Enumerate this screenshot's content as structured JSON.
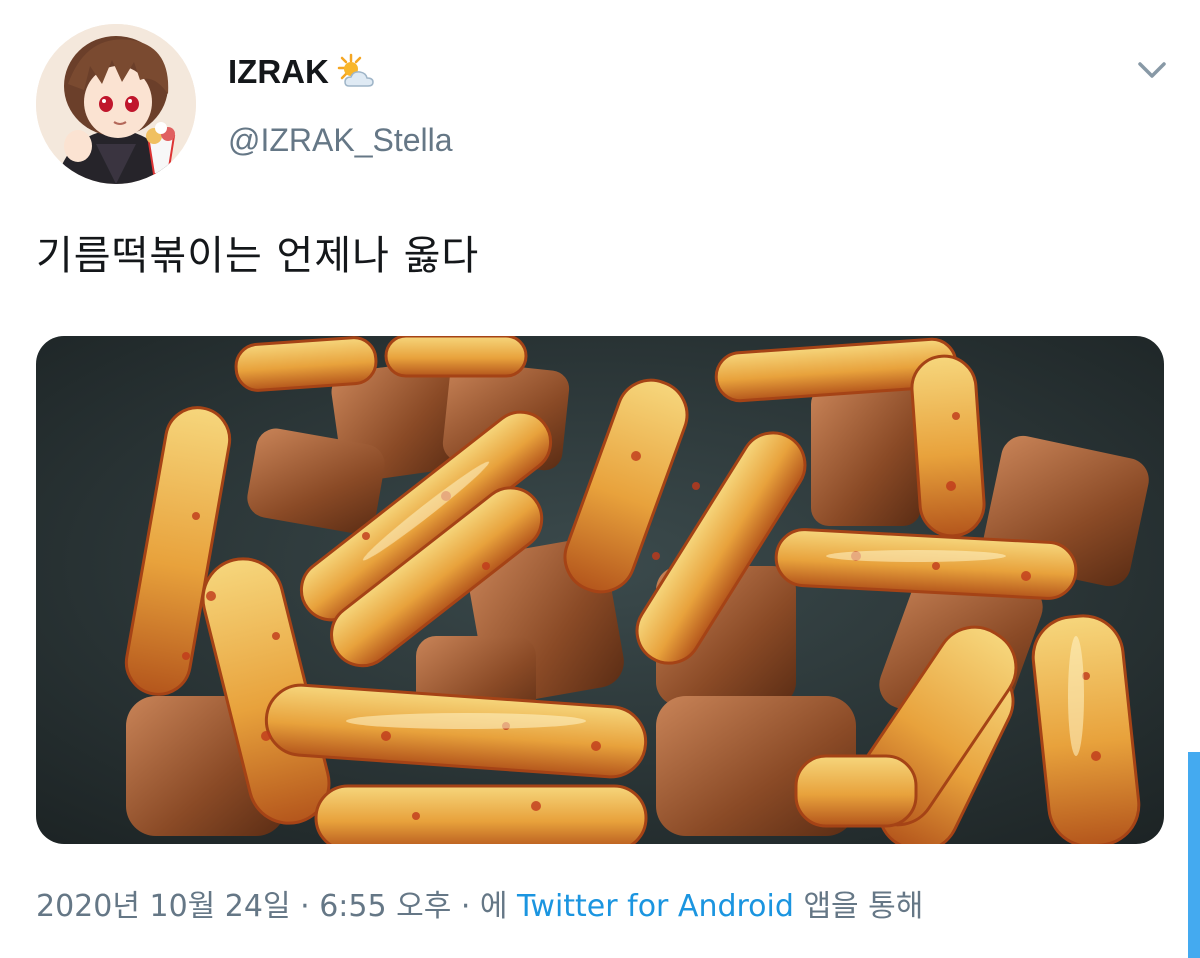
{
  "user": {
    "display_name": "IZRAK",
    "display_name_icon": "sun-behind-cloud-icon",
    "handle": "@IZRAK_Stella",
    "avatar": "anime-character-avatar"
  },
  "menu": {
    "icon": "chevron-down-icon"
  },
  "tweet": {
    "text": "기름떡볶이는 언제나 옳다",
    "media": "fried-tteokbokki-photo"
  },
  "meta": {
    "date": "2020년 10월 24일",
    "sep1": " · ",
    "time": "6:55 오후",
    "sep2": " · ",
    "via_prefix": "에 ",
    "source": "Twitter for Android",
    "via_suffix": " 앱을 통해"
  },
  "colors": {
    "text": "#14171a",
    "secondary": "#657786",
    "link": "#1b95e0",
    "scroll": "#44aaf0"
  }
}
